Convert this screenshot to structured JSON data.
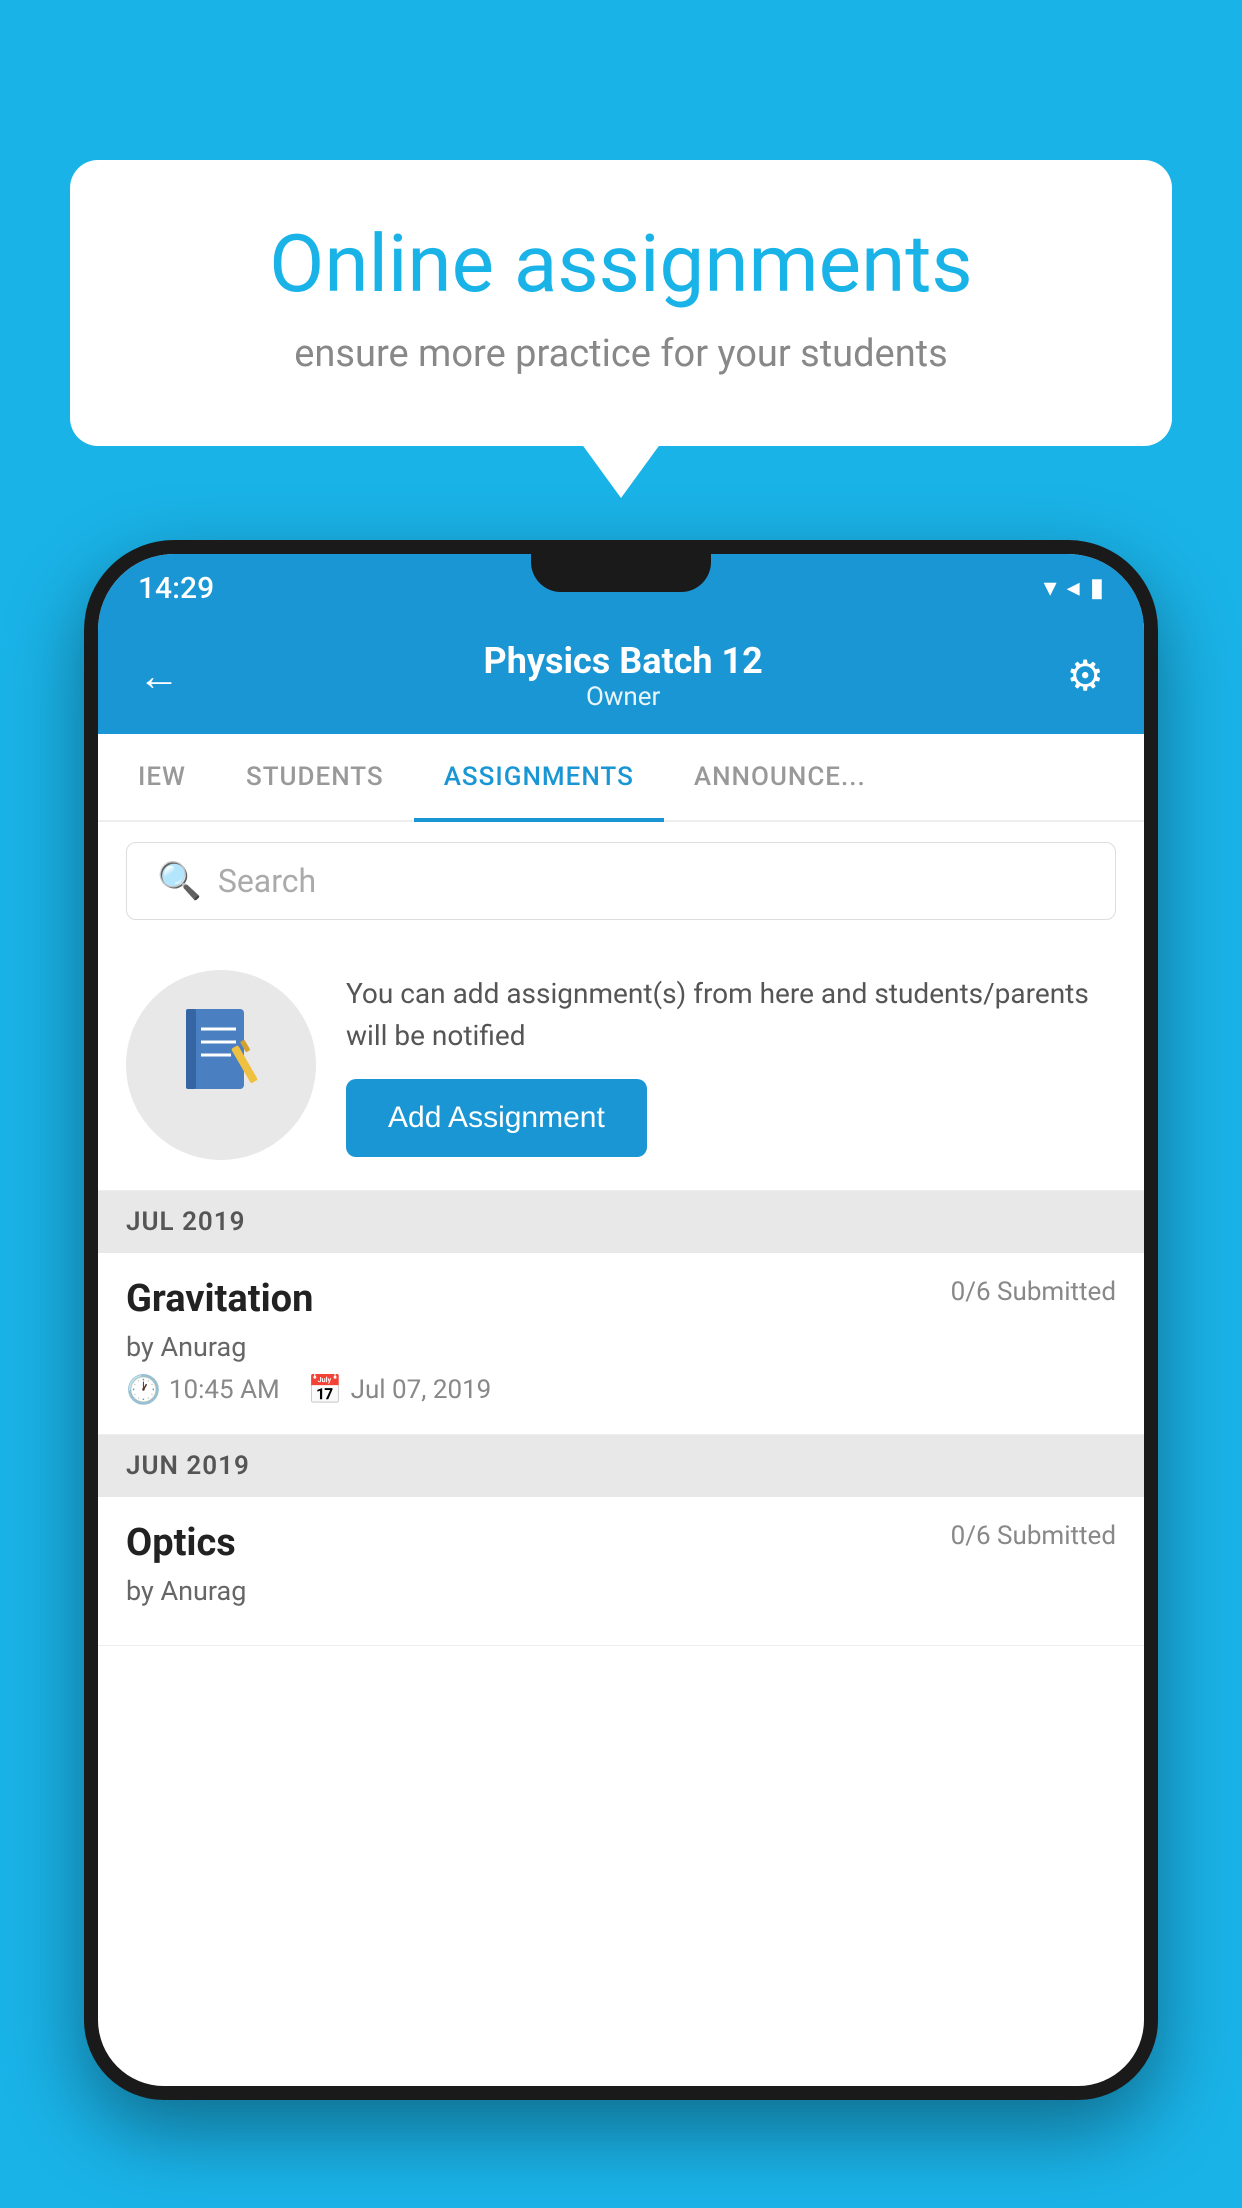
{
  "background_color": "#1ab3e8",
  "speech_bubble": {
    "title": "Online assignments",
    "subtitle": "ensure more practice for your students"
  },
  "status_bar": {
    "time": "14:29",
    "icons": "▼◀█"
  },
  "app_header": {
    "title": "Physics Batch 12",
    "subtitle": "Owner",
    "back_label": "←",
    "gear_label": "⚙"
  },
  "tabs": [
    {
      "label": "IEW",
      "active": false
    },
    {
      "label": "STUDENTS",
      "active": false
    },
    {
      "label": "ASSIGNMENTS",
      "active": true
    },
    {
      "label": "ANNOUNCE...",
      "active": false
    }
  ],
  "search": {
    "placeholder": "Search"
  },
  "promo": {
    "icon": "📓",
    "text": "You can add assignment(s) from here and students/parents will be notified",
    "button_label": "Add Assignment"
  },
  "assignments": [
    {
      "month_header": "JUL 2019",
      "items": [
        {
          "name": "Gravitation",
          "submitted": "0/6 Submitted",
          "author": "by Anurag",
          "time": "10:45 AM",
          "date": "Jul 07, 2019"
        }
      ]
    },
    {
      "month_header": "JUN 2019",
      "items": [
        {
          "name": "Optics",
          "submitted": "0/6 Submitted",
          "author": "by Anurag",
          "time": "",
          "date": ""
        }
      ]
    }
  ]
}
